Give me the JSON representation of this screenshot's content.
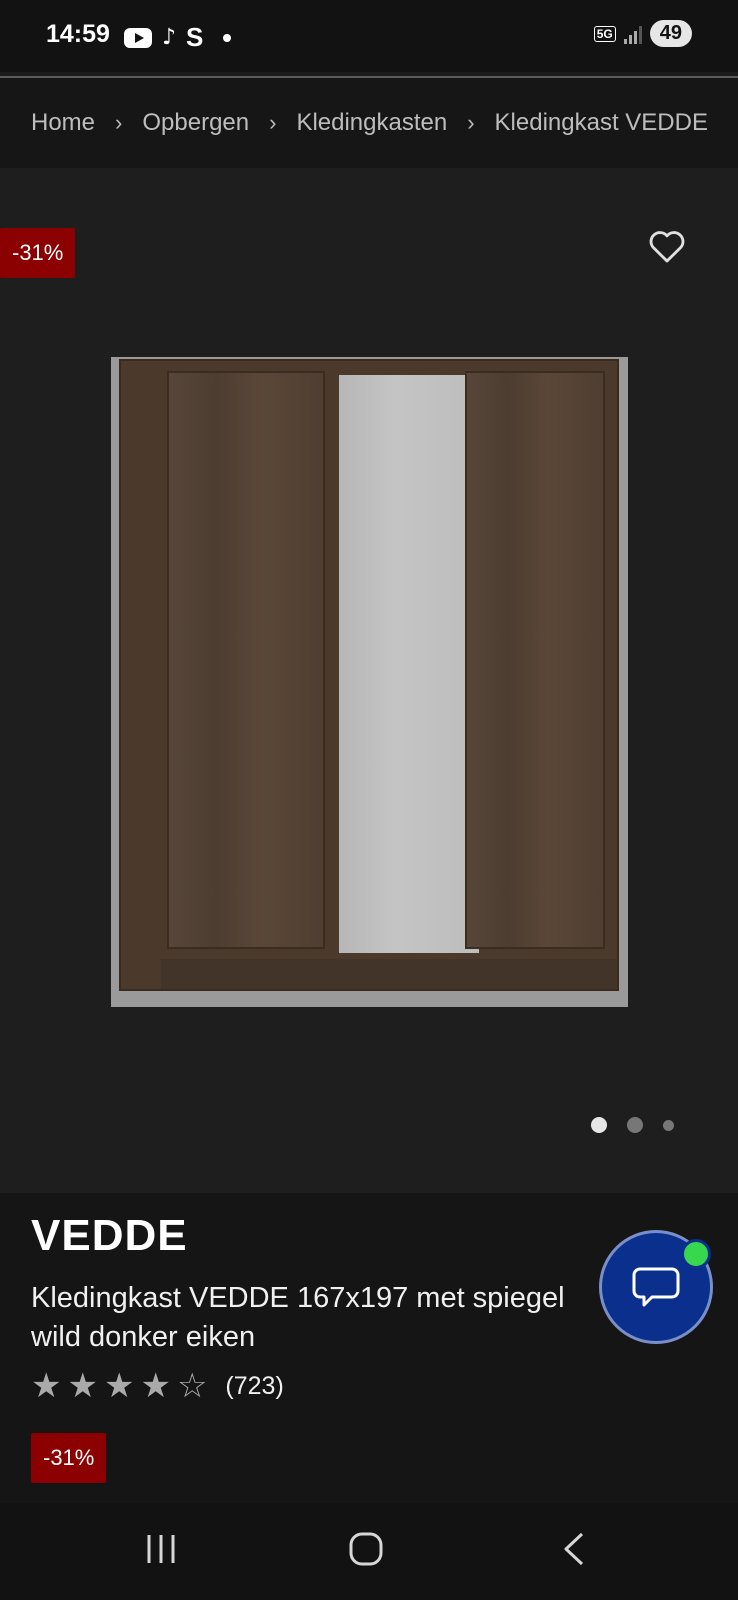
{
  "status_bar": {
    "time": "14:59",
    "network": "5G",
    "battery": "49",
    "app_letter": "S",
    "tiktok_glyph": "♪"
  },
  "breadcrumb": {
    "items": [
      "Home",
      "Opbergen",
      "Kledingkasten",
      "Kledingkast VEDDE"
    ],
    "separator": "›"
  },
  "gallery": {
    "discount_badge": "-31%",
    "image_count": 3,
    "active_index": 0
  },
  "product": {
    "brand": "VEDDE",
    "title": "Kledingkast VEDDE 167x197 met spiegel wild donker eiken",
    "rating_stars": 4,
    "rating_max": 5,
    "review_count": "(723)",
    "discount_badge": "-31%"
  },
  "colors": {
    "badge": "#8b0000",
    "chat": "#0a2f8c",
    "online": "#37d84e"
  }
}
